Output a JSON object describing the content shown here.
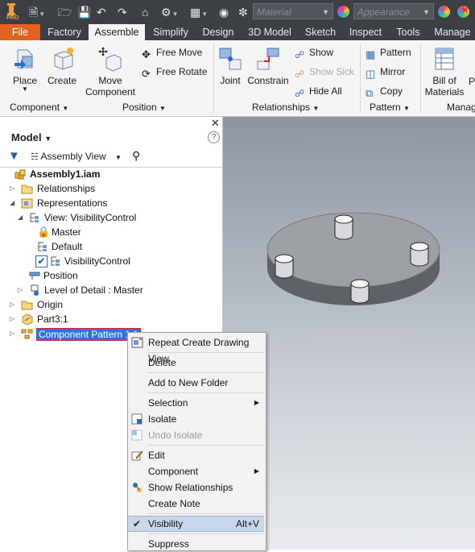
{
  "qat": {
    "material_placeholder": "Material",
    "appearance_placeholder": "Appearance",
    "app_badge": "PRO"
  },
  "tabs": [
    "File",
    "Factory",
    "Assemble",
    "Simplify",
    "Design",
    "3D Model",
    "Sketch",
    "Inspect",
    "Tools",
    "Manage"
  ],
  "active_tab": "Assemble",
  "ribbon": {
    "place": "Place",
    "create": "Create",
    "move_component": [
      "Move",
      "Component"
    ],
    "free_move": "Free Move",
    "free_rotate": "Free Rotate",
    "joint": "Joint",
    "constrain": "Constrain",
    "show": "Show",
    "show_sick": "Show Sick",
    "hide_all": "Hide All",
    "pattern": "Pattern",
    "mirror": "Mirror",
    "copy": "Copy",
    "bill_of_materials": [
      "Bill of",
      "Materials"
    ],
    "partial_next": "Pa",
    "panels": {
      "component": "Component",
      "position": "Position",
      "relationships": "Relationships",
      "pattern": "Pattern",
      "manage": "Manag"
    }
  },
  "browser": {
    "title": "Model",
    "view_label": "Assembly View",
    "tree": {
      "root": "Assembly1.iam",
      "relationships": "Relationships",
      "representations": "Representations",
      "view_rep": "View: VisibilityControl",
      "master": "Master",
      "default": "Default",
      "visibility_control": "VisibilityControl",
      "position": "Position",
      "lod": "Level of Detail : Master",
      "origin": "Origin",
      "part3": "Part3:1",
      "component_pattern": "Component Pattern 1:1"
    }
  },
  "context_menu": {
    "repeat": "Repeat Create Drawing View",
    "delete": "Delete",
    "add_folder": "Add to New Folder",
    "selection": "Selection",
    "isolate": "Isolate",
    "undo_isolate": "Undo Isolate",
    "edit": "Edit",
    "component": "Component",
    "show_relationships": "Show Relationships",
    "create_note": "Create Note",
    "visibility": "Visibility",
    "visibility_shortcut": "Alt+V",
    "suppress": "Suppress"
  },
  "colors": {
    "file_tab": "#e2631f",
    "selection_highlight": "#c9d7ea",
    "tree_selected": "#3173d6"
  }
}
